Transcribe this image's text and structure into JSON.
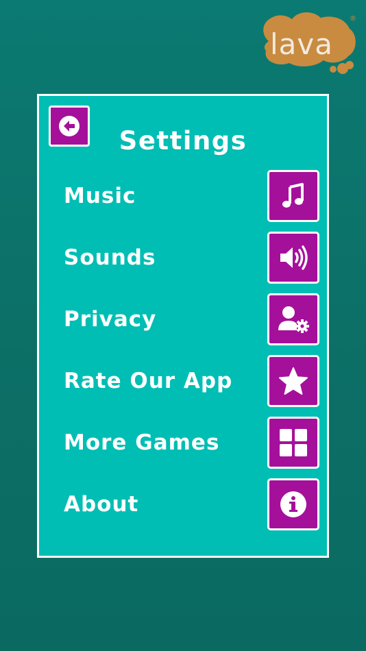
{
  "logo": {
    "text": "lava",
    "registered": "®"
  },
  "settings": {
    "title": "Settings",
    "items": [
      {
        "label": "Music",
        "icon": "music-note-icon"
      },
      {
        "label": "Sounds",
        "icon": "speaker-volume-icon"
      },
      {
        "label": "Privacy",
        "icon": "user-settings-icon"
      },
      {
        "label": "Rate Our App",
        "icon": "star-icon"
      },
      {
        "label": "More Games",
        "icon": "grid-icon"
      },
      {
        "label": "About",
        "icon": "info-icon"
      }
    ]
  },
  "colors": {
    "background": "#0b7a72",
    "panel": "#00beb4",
    "button": "#a5109b",
    "logo": "#c98b40",
    "text": "#ffffff"
  }
}
